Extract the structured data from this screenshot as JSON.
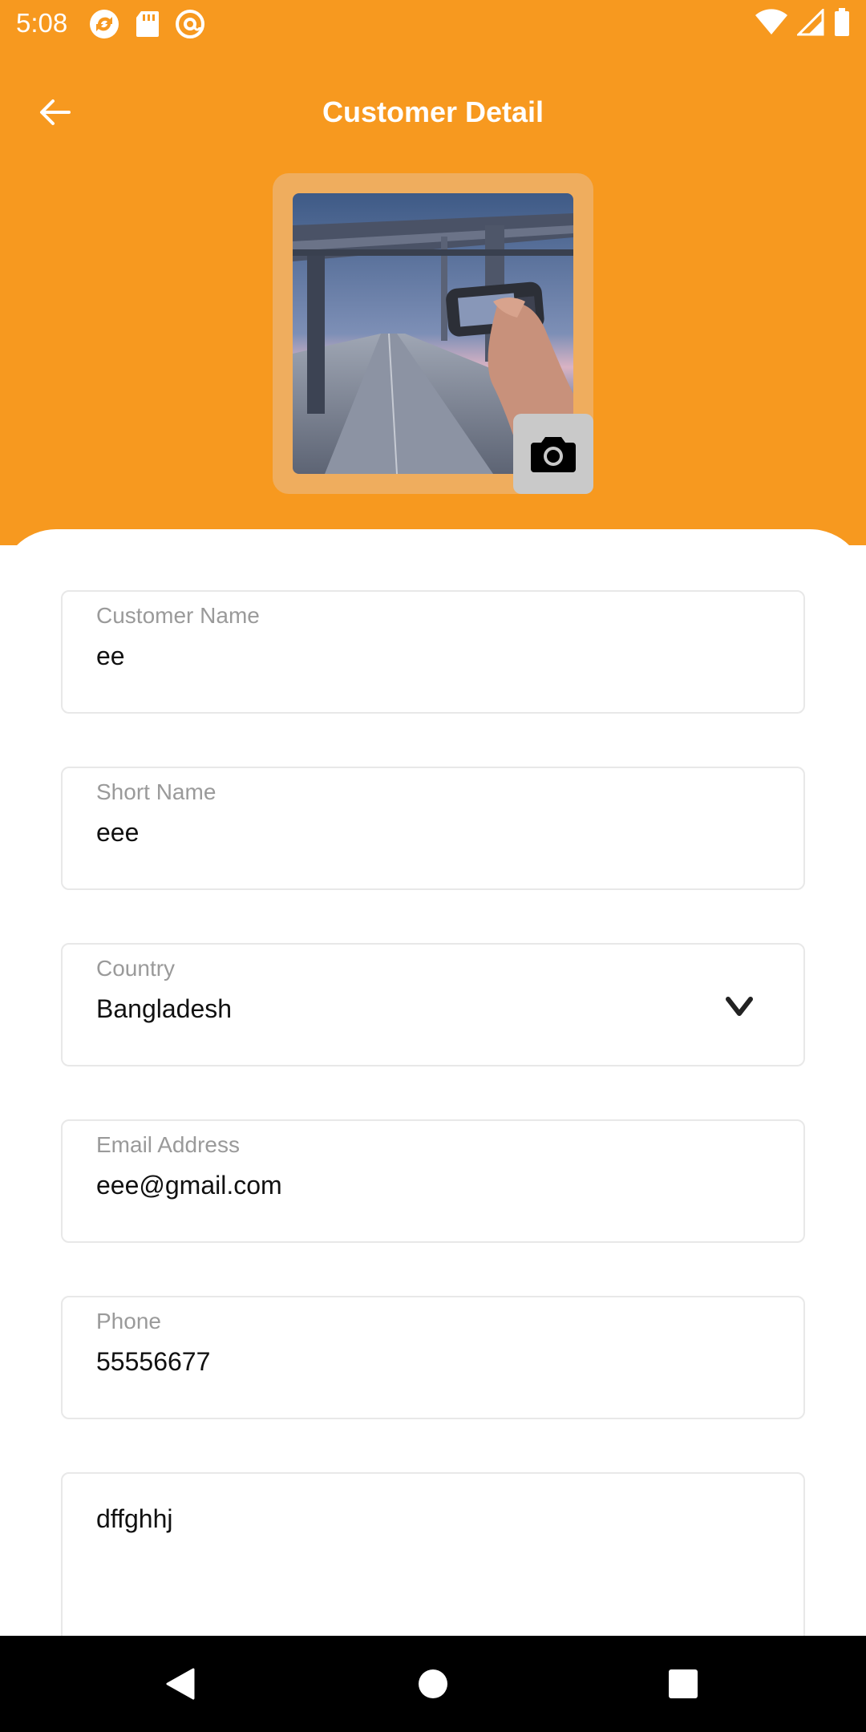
{
  "status_bar": {
    "time": "5:08",
    "left_icons": [
      "sync-icon",
      "sd-card-icon",
      "at-sign-icon"
    ],
    "right_icons": [
      "wifi-icon",
      "signal-icon",
      "battery-icon"
    ]
  },
  "header": {
    "title": "Customer Detail",
    "back_icon": "arrow-left-icon",
    "background_color": "#F7991F"
  },
  "photo": {
    "camera_icon": "camera-icon"
  },
  "form": {
    "customer_name": {
      "label": "Customer Name",
      "value": "ee"
    },
    "short_name": {
      "label": "Short Name",
      "value": "eee"
    },
    "country": {
      "label": "Country",
      "value": "Bangladesh",
      "icon": "chevron-down-icon"
    },
    "email": {
      "label": "Email Address",
      "value": "eee@gmail.com"
    },
    "phone": {
      "label": "Phone",
      "value": "55556677"
    },
    "address": {
      "value": "dffghhj"
    }
  },
  "nav_bar": {
    "icons": [
      "back-triangle-icon",
      "home-circle-icon",
      "recents-square-icon"
    ]
  }
}
